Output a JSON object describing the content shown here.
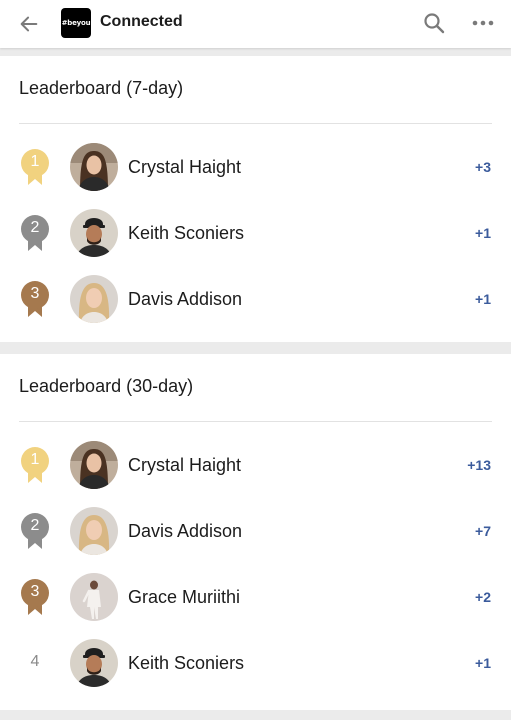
{
  "header": {
    "back_icon": "arrow-left-icon",
    "logo_text": "#beyou",
    "title": "Connected",
    "search_icon": "search-icon",
    "more_icon": "more-horizontal-icon"
  },
  "colors": {
    "gold": "#f1d27f",
    "silver": "#8c8c8c",
    "bronze": "#a5794e",
    "score": "#3b5b9c"
  },
  "leaderboard_7": {
    "title": "Leaderboard (7-day)",
    "rows": [
      {
        "rank": "1",
        "medal": "gold",
        "name": "Crystal Haight",
        "score": "+3",
        "avatar": "woman-long-hair"
      },
      {
        "rank": "2",
        "medal": "silver",
        "name": "Keith Sconiers",
        "score": "+1",
        "avatar": "man-cap"
      },
      {
        "rank": "3",
        "medal": "bronze",
        "name": "Davis Addison",
        "score": "+1",
        "avatar": "woman-blonde"
      }
    ]
  },
  "leaderboard_30": {
    "title": "Leaderboard (30-day)",
    "rows": [
      {
        "rank": "1",
        "medal": "gold",
        "name": "Crystal Haight",
        "score": "+13",
        "avatar": "woman-long-hair"
      },
      {
        "rank": "2",
        "medal": "silver",
        "name": "Davis Addison",
        "score": "+7",
        "avatar": "woman-blonde"
      },
      {
        "rank": "3",
        "medal": "bronze",
        "name": "Grace Muriithi",
        "score": "+2",
        "avatar": "woman-standing"
      },
      {
        "rank": "4",
        "medal": "none",
        "name": "Keith Sconiers",
        "score": "+1",
        "avatar": "man-cap"
      }
    ]
  }
}
